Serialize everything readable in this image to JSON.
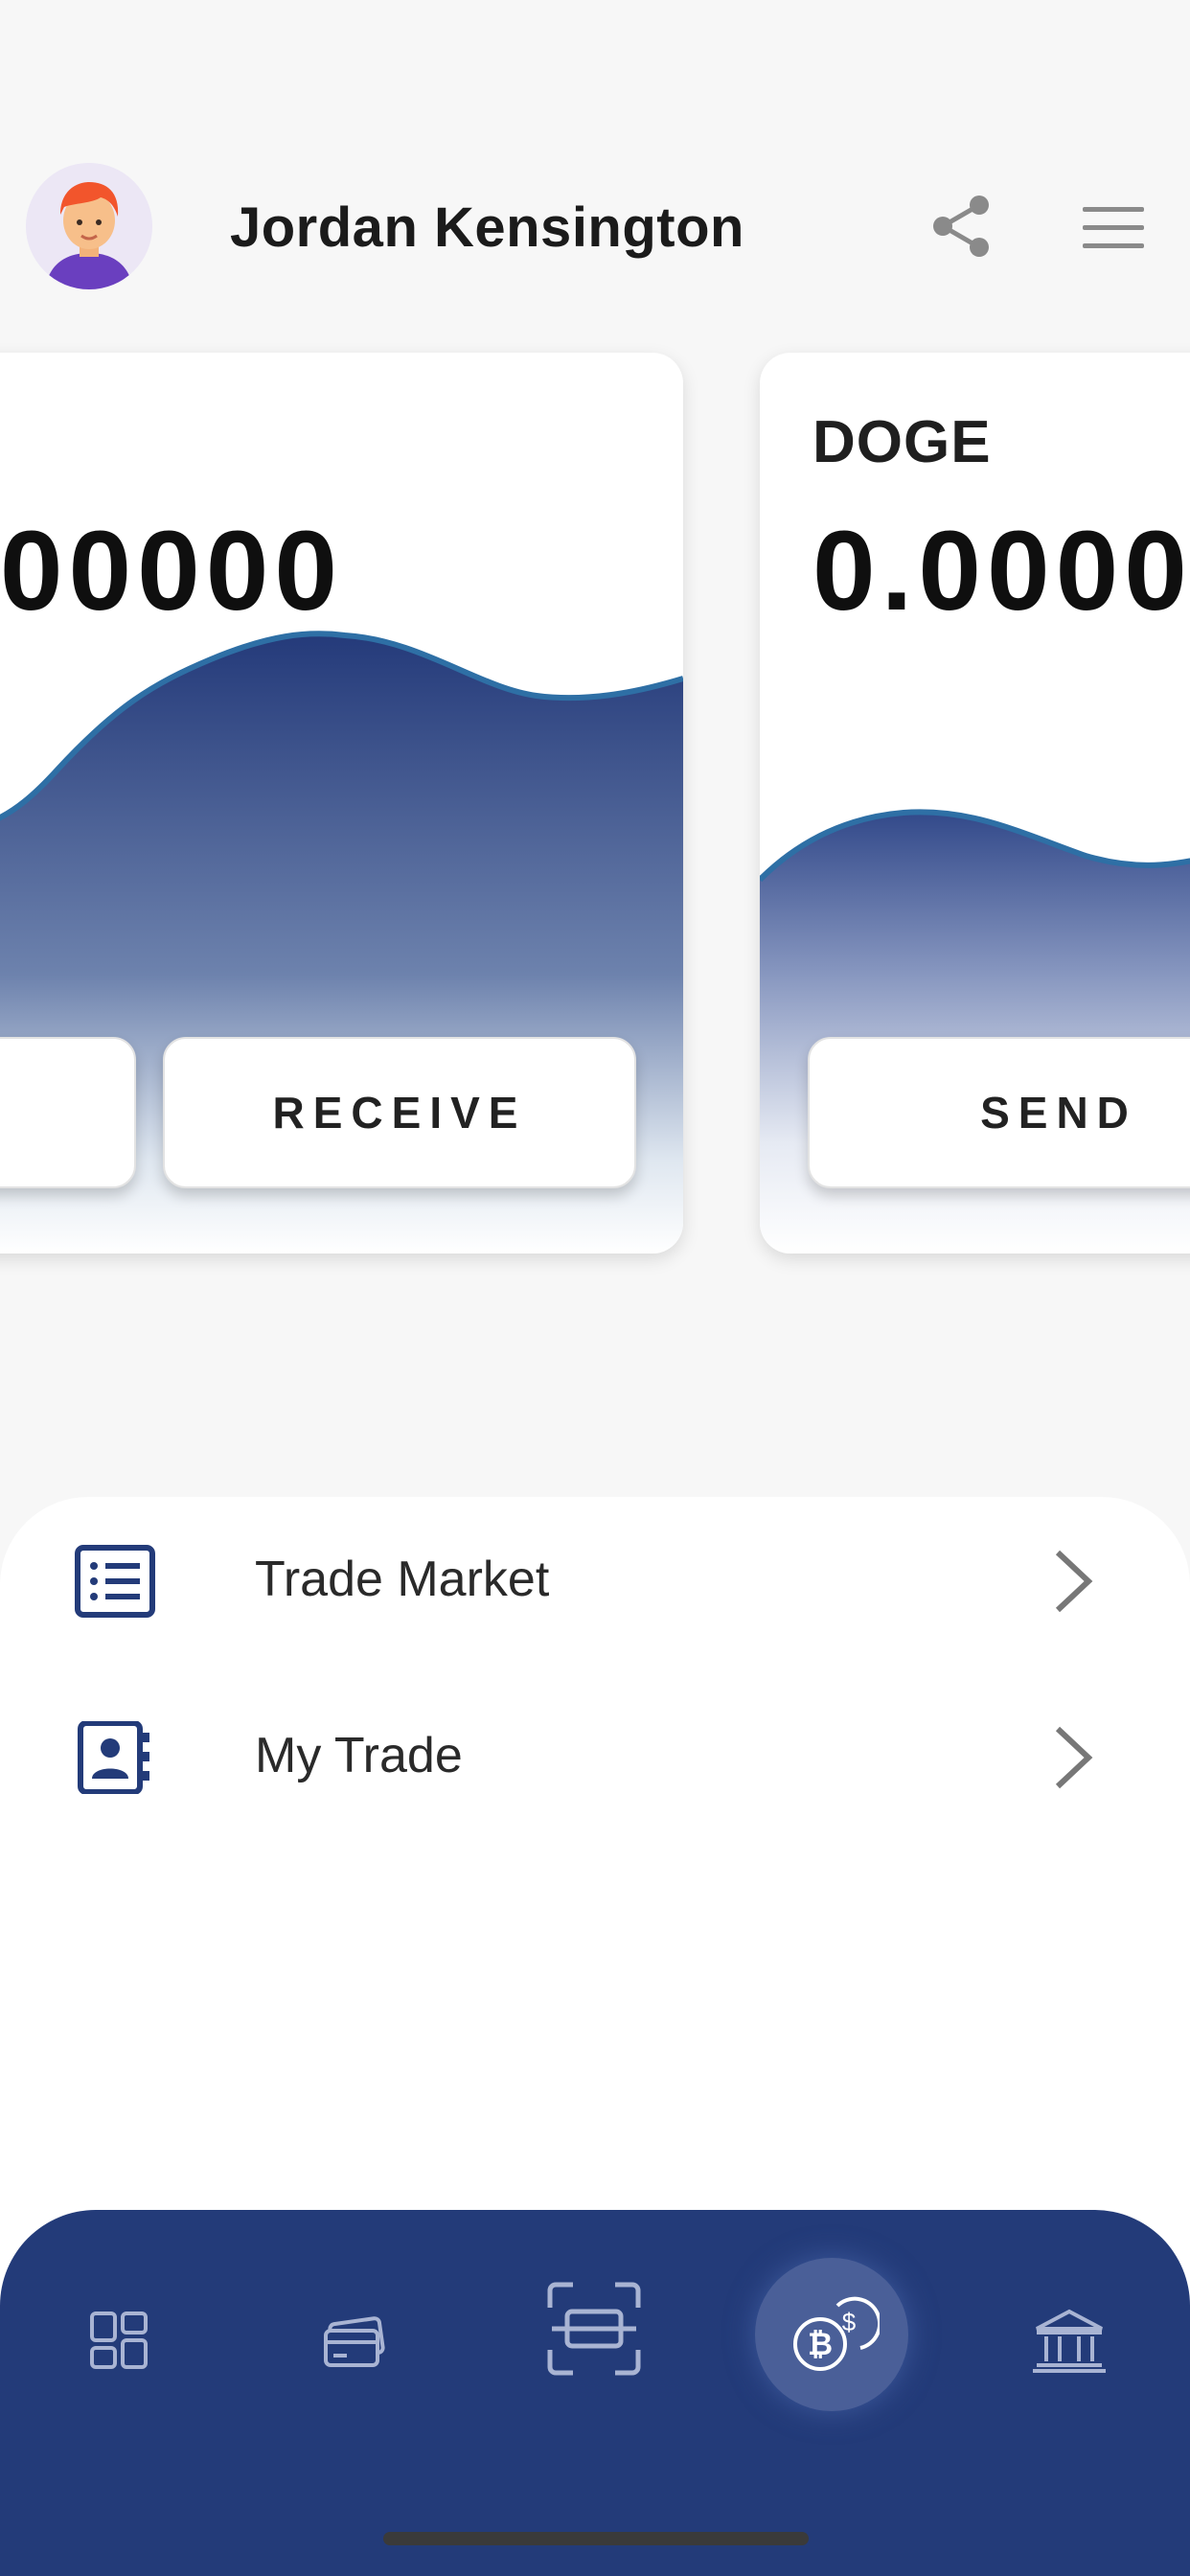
{
  "header": {
    "user_name": "Jordan Kensington",
    "avatar_icon": "user-avatar-icon",
    "share_icon": "share-icon",
    "menu_icon": "hamburger-menu-icon"
  },
  "cards": [
    {
      "symbol": "",
      "balance": "00000",
      "buttons": [
        "",
        "RECEIVE"
      ]
    },
    {
      "symbol": "DOGE",
      "balance": "0.0000",
      "buttons": [
        "SEND"
      ]
    }
  ],
  "list": [
    {
      "label": "Trade Market",
      "icon": "list-document-icon",
      "chevron": "chevron-right-icon"
    },
    {
      "label": "My Trade",
      "icon": "contact-book-icon",
      "chevron": "chevron-right-icon"
    }
  ],
  "bottom_nav": {
    "items": [
      {
        "icon": "dashboard-grid-icon"
      },
      {
        "icon": "cards-icon"
      },
      {
        "icon": "scan-icon"
      },
      {
        "icon": "crypto-exchange-icon",
        "active": true
      },
      {
        "icon": "bank-icon"
      }
    ]
  },
  "colors": {
    "nav_bg": "#233b79",
    "accent": "#233b79",
    "chart_top": "#263f7e",
    "chart_line": "#2e6fa5"
  }
}
